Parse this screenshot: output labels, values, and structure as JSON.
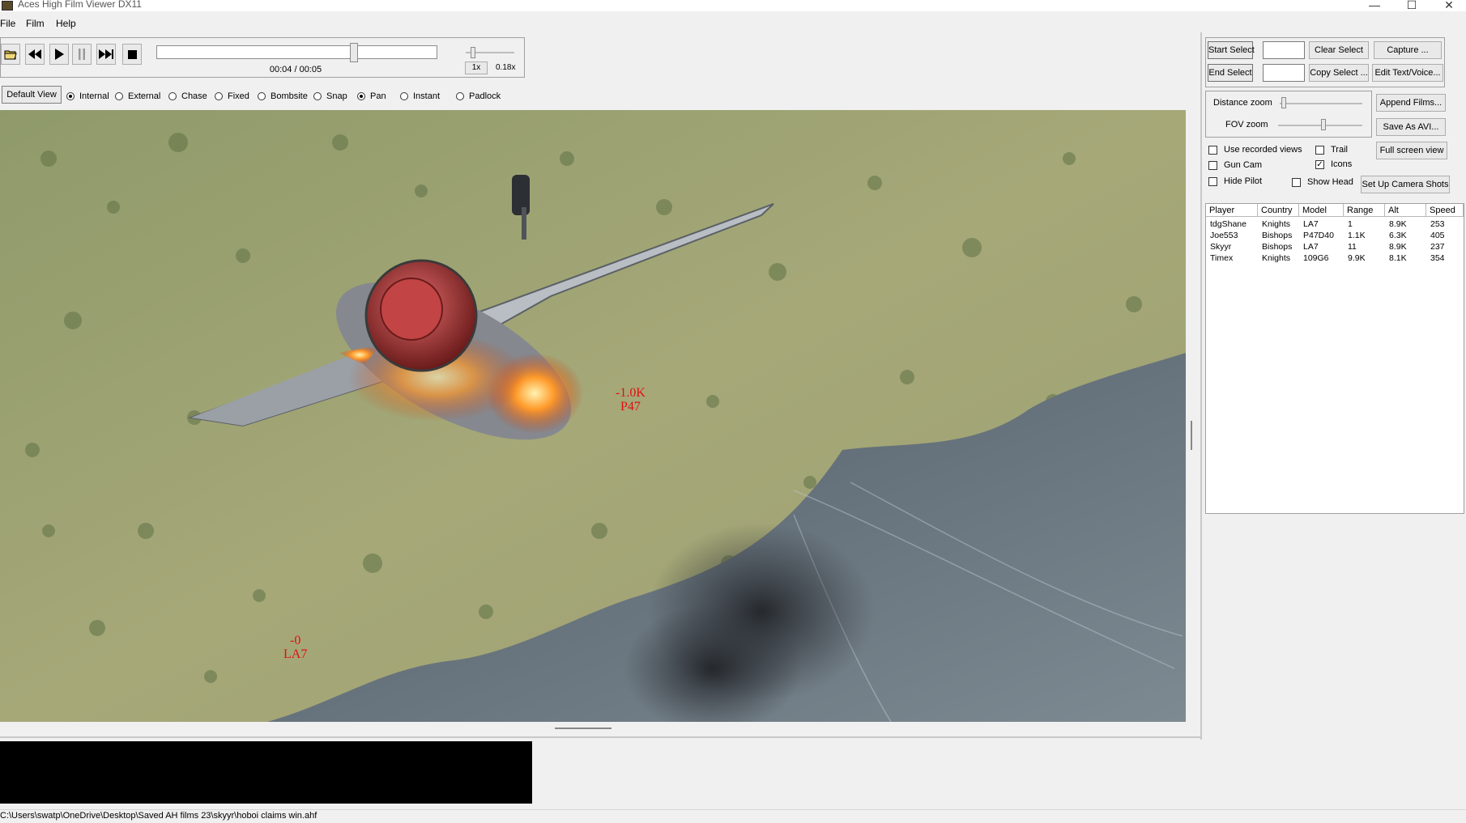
{
  "window": {
    "title": "Aces High Film Viewer DX11",
    "controls": [
      "—",
      "☐",
      "✕"
    ]
  },
  "menu": [
    "File",
    "Film",
    "Help"
  ],
  "transport": {
    "time": "00:04 / 00:05",
    "progress_fraction": 0.71,
    "speed_button": "1x",
    "speed_value": "0.18x",
    "speed_fraction": 0.12
  },
  "view": {
    "default_button": "Default View",
    "modes": [
      {
        "label": "Internal",
        "selected": true
      },
      {
        "label": "External",
        "selected": false
      },
      {
        "label": "Chase",
        "selected": false
      },
      {
        "label": "Fixed",
        "selected": false
      },
      {
        "label": "Bombsite",
        "selected": false
      },
      {
        "label": "Snap",
        "selected": false
      },
      {
        "label": "Pan",
        "selected": true
      },
      {
        "label": "Instant",
        "selected": false
      },
      {
        "label": "Padlock",
        "selected": false
      }
    ]
  },
  "viewport": {
    "markers": [
      {
        "range": "-1.0K",
        "model": "P47"
      },
      {
        "range": "-0",
        "model": "LA7"
      }
    ],
    "marker_color": "#e01010"
  },
  "panel": {
    "start_select": "Start Select",
    "end_select": "End Select",
    "clear_select": "Clear Select",
    "copy_select": "Copy Select ...",
    "capture": "Capture ...",
    "edit_text_voice": "Edit Text/Voice...",
    "distance_zoom": "Distance zoom",
    "fov_zoom": "FOV zoom",
    "distance_zoom_fraction": 0.05,
    "fov_zoom_fraction": 0.5,
    "append_films": "Append Films...",
    "save_as_avi": "Save As AVI...",
    "full_screen_view": "Full screen view",
    "set_up_camera_shots": "Set Up Camera Shots",
    "checkboxes": {
      "use_recorded_views": {
        "label": "Use recorded views",
        "checked": false
      },
      "trail": {
        "label": "Trail",
        "checked": false
      },
      "gun_cam": {
        "label": "Gun Cam",
        "checked": false
      },
      "icons": {
        "label": "Icons",
        "checked": true
      },
      "hide_pilot": {
        "label": "Hide Pilot",
        "checked": false
      },
      "show_head": {
        "label": "Show Head",
        "checked": false
      }
    }
  },
  "table": {
    "columns": [
      "Player",
      "Country",
      "Model",
      "Range",
      "Alt",
      "Speed"
    ],
    "rows": [
      [
        "tdgShane",
        "Knights",
        "LA7",
        "1",
        "8.9K",
        "253"
      ],
      [
        "Joe553",
        "Bishops",
        "P47D40",
        "1.1K",
        "6.3K",
        "405"
      ],
      [
        "Skyyr",
        "Bishops",
        "LA7",
        "11",
        "8.9K",
        "237"
      ],
      [
        "Timex",
        "Knights",
        "109G6",
        "9.9K",
        "8.1K",
        "354"
      ]
    ]
  },
  "status": {
    "path": "C:\\Users\\swatp\\OneDrive\\Desktop\\Saved AH films 23\\skyyr\\hoboi claims win.ahf"
  }
}
